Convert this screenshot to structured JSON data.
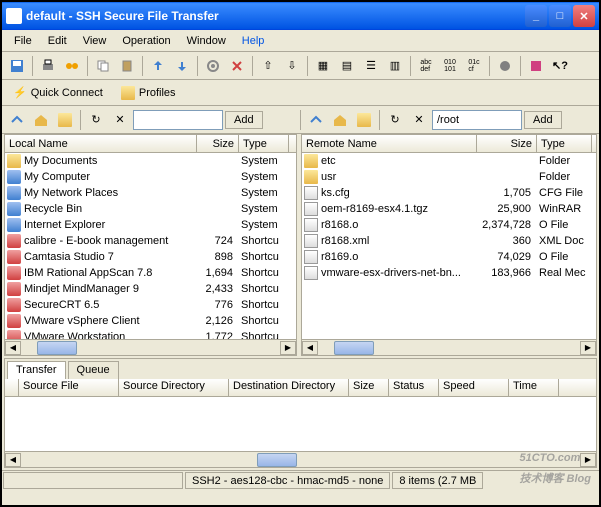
{
  "window": {
    "title": "default - SSH Secure File Transfer"
  },
  "menu": {
    "file": "File",
    "edit": "Edit",
    "view": "View",
    "operation": "Operation",
    "window": "Window",
    "help": "Help"
  },
  "quickbar": {
    "connect": "Quick Connect",
    "profiles": "Profiles"
  },
  "nav": {
    "add": "Add",
    "remote_path": "/root"
  },
  "local": {
    "header": {
      "name": "Local Name",
      "size": "Size",
      "type": "Type"
    },
    "col_widths": {
      "name": 192,
      "size": 42,
      "type": 50
    },
    "items": [
      {
        "name": "My Documents",
        "size": "",
        "type": "System",
        "icon": "folder"
      },
      {
        "name": "My Computer",
        "size": "",
        "type": "System",
        "icon": "sys"
      },
      {
        "name": "My Network Places",
        "size": "",
        "type": "System",
        "icon": "sys"
      },
      {
        "name": "Recycle Bin",
        "size": "",
        "type": "System",
        "icon": "sys"
      },
      {
        "name": "Internet Explorer",
        "size": "",
        "type": "System",
        "icon": "sys"
      },
      {
        "name": "calibre - E-book management",
        "size": "724",
        "type": "Shortcu",
        "icon": "app"
      },
      {
        "name": "Camtasia Studio 7",
        "size": "898",
        "type": "Shortcu",
        "icon": "app"
      },
      {
        "name": "IBM Rational AppScan 7.8",
        "size": "1,694",
        "type": "Shortcu",
        "icon": "app"
      },
      {
        "name": "Mindjet MindManager 9",
        "size": "2,433",
        "type": "Shortcu",
        "icon": "app"
      },
      {
        "name": "SecureCRT 6.5",
        "size": "776",
        "type": "Shortcu",
        "icon": "app"
      },
      {
        "name": "VMware vSphere Client",
        "size": "2,126",
        "type": "Shortcu",
        "icon": "app"
      },
      {
        "name": "VMware Workstation",
        "size": "1,772",
        "type": "Shortcu",
        "icon": "app"
      }
    ]
  },
  "remote": {
    "header": {
      "name": "Remote Name",
      "size": "Size",
      "type": "Type"
    },
    "col_widths": {
      "name": 175,
      "size": 60,
      "type": 55
    },
    "items": [
      {
        "name": "etc",
        "size": "",
        "type": "Folder",
        "icon": "folder"
      },
      {
        "name": "usr",
        "size": "",
        "type": "Folder",
        "icon": "folder"
      },
      {
        "name": "ks.cfg",
        "size": "1,705",
        "type": "CFG File",
        "icon": "file"
      },
      {
        "name": "oem-r8169-esx4.1.tgz",
        "size": "25,900",
        "type": "WinRAR",
        "icon": "file"
      },
      {
        "name": "r8168.o",
        "size": "2,374,728",
        "type": "O File",
        "icon": "file"
      },
      {
        "name": "r8168.xml",
        "size": "360",
        "type": "XML Doc",
        "icon": "file"
      },
      {
        "name": "r8169.o",
        "size": "74,029",
        "type": "O File",
        "icon": "file"
      },
      {
        "name": "vmware-esx-drivers-net-bn...",
        "size": "183,966",
        "type": "Real Mec",
        "icon": "file"
      }
    ]
  },
  "transfer": {
    "tabs": {
      "transfer": "Transfer",
      "queue": "Queue"
    },
    "header": {
      "source_file": "Source File",
      "source_dir": "Source Directory",
      "dest_dir": "Destination Directory",
      "size": "Size",
      "status": "Status",
      "speed": "Speed",
      "time": "Time"
    }
  },
  "status": {
    "cipher": "SSH2 - aes128-cbc - hmac-md5 - none",
    "items": "8 items (2.7 MB"
  },
  "watermark": {
    "text": "51CTO.com",
    "sub": "技术博客 Blog"
  }
}
